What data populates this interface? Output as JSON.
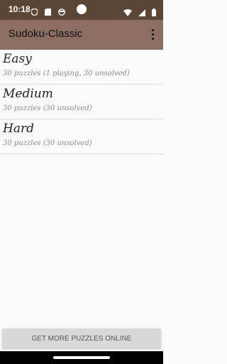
{
  "status_bar": {
    "time": "10:18",
    "icons_left": [
      "shield-icon",
      "sd-card-icon",
      "face-icon"
    ],
    "icons_right": [
      "wifi-icon",
      "signal-icon",
      "battery-icon"
    ]
  },
  "app_bar": {
    "title": "Sudoku-Classic",
    "menu_icon": "overflow-menu-icon"
  },
  "levels": [
    {
      "name": "Easy",
      "info": "30 puzzles (1 playing, 30 unsolved)"
    },
    {
      "name": "Medium",
      "info": "30 puzzles (30 unsolved)"
    },
    {
      "name": "Hard",
      "info": "30 puzzles (30 unsolved)"
    }
  ],
  "footer": {
    "get_more_label": "GET MORE PUZZLES ONLINE"
  },
  "colors": {
    "status_bar": "#5b4636",
    "app_bar": "#8d6e63",
    "background": "#fafafa"
  }
}
